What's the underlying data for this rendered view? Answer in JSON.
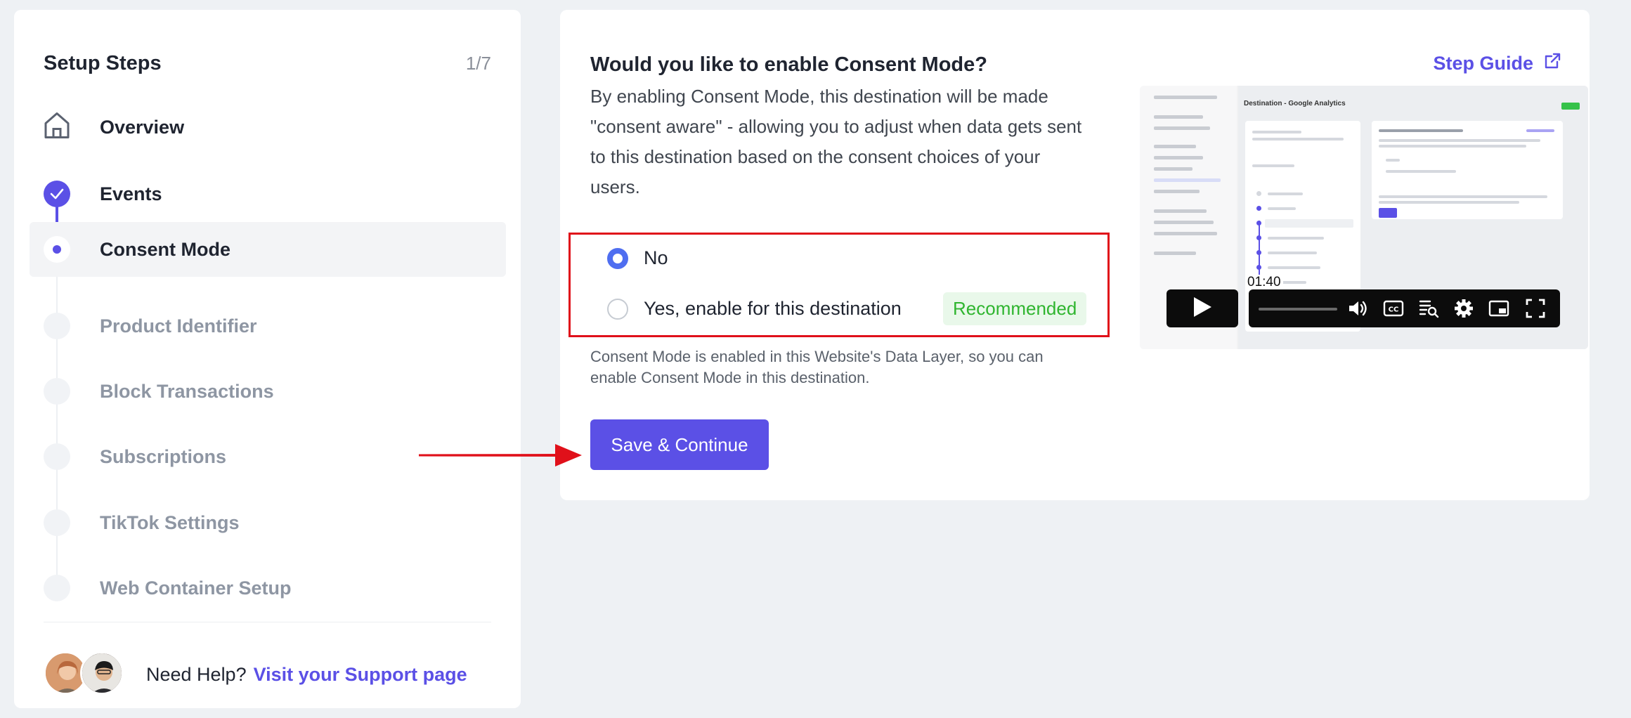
{
  "sidebar": {
    "title": "Setup Steps",
    "count": "1/7",
    "steps": [
      {
        "label": "Overview",
        "state": "home"
      },
      {
        "label": "Events",
        "state": "done"
      },
      {
        "label": "Consent Mode",
        "state": "current"
      },
      {
        "label": "Product Identifier",
        "state": "pending"
      },
      {
        "label": "Block Transactions",
        "state": "pending"
      },
      {
        "label": "Subscriptions",
        "state": "pending"
      },
      {
        "label": "TikTok Settings",
        "state": "pending"
      },
      {
        "label": "Web Container Setup",
        "state": "pending"
      }
    ],
    "help_text": "Need Help?",
    "help_link": "Visit your Support page"
  },
  "main": {
    "question": "Would you like to enable Consent Mode?",
    "step_guide": "Step Guide",
    "description": "By enabling Consent Mode, this destination will be made \"consent aware\" - allowing you to adjust when data gets sent to this destination based on the consent choices of your users.",
    "options": [
      {
        "label": "No",
        "checked": true
      },
      {
        "label": "Yes, enable for this destination",
        "checked": false
      }
    ],
    "recommended_badge": "Recommended",
    "note": "Consent Mode is enabled in this Website's Data Layer, so you can enable Consent Mode in this destination.",
    "save_button": "Save & Continue"
  },
  "video": {
    "time": "01:40",
    "thumb_header": "Destination - Google Analytics"
  },
  "colors": {
    "accent": "#5b50e6",
    "radio_checked": "#4f6ef0",
    "recommended_bg": "#e9f8ea",
    "recommended_text": "#2fb52f",
    "highlight_border": "#e0101a",
    "annotation_arrow": "#e0101a"
  },
  "icons": {
    "overview": "home-icon",
    "events": "check-icon",
    "step_guide": "external-link-icon",
    "video_controls": [
      "play-icon",
      "volume-icon",
      "captions-icon",
      "playlist-icon",
      "settings-icon",
      "pip-icon",
      "fullscreen-icon"
    ]
  }
}
